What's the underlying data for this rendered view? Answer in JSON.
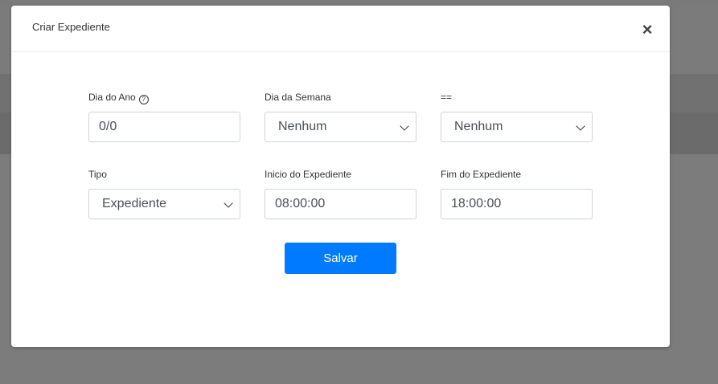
{
  "modal": {
    "title": "Criar Expediente",
    "close_label": "×"
  },
  "form": {
    "dia_do_ano": {
      "label": "Dia do Ano",
      "help_icon": "?",
      "value": "0/0"
    },
    "dia_da_semana": {
      "label": "Dia da Semana",
      "value": "Nenhum"
    },
    "operador": {
      "label": "==",
      "value": "Nenhum"
    },
    "tipo": {
      "label": "Tipo",
      "value": "Expediente"
    },
    "inicio": {
      "label": "Inicio do Expediente",
      "value": "08:00:00"
    },
    "fim": {
      "label": "Fim do Expediente",
      "value": "18:00:00"
    }
  },
  "actions": {
    "save_label": "Salvar"
  },
  "colors": {
    "primary": "#007bff",
    "overlay": "#7b7b7b"
  }
}
